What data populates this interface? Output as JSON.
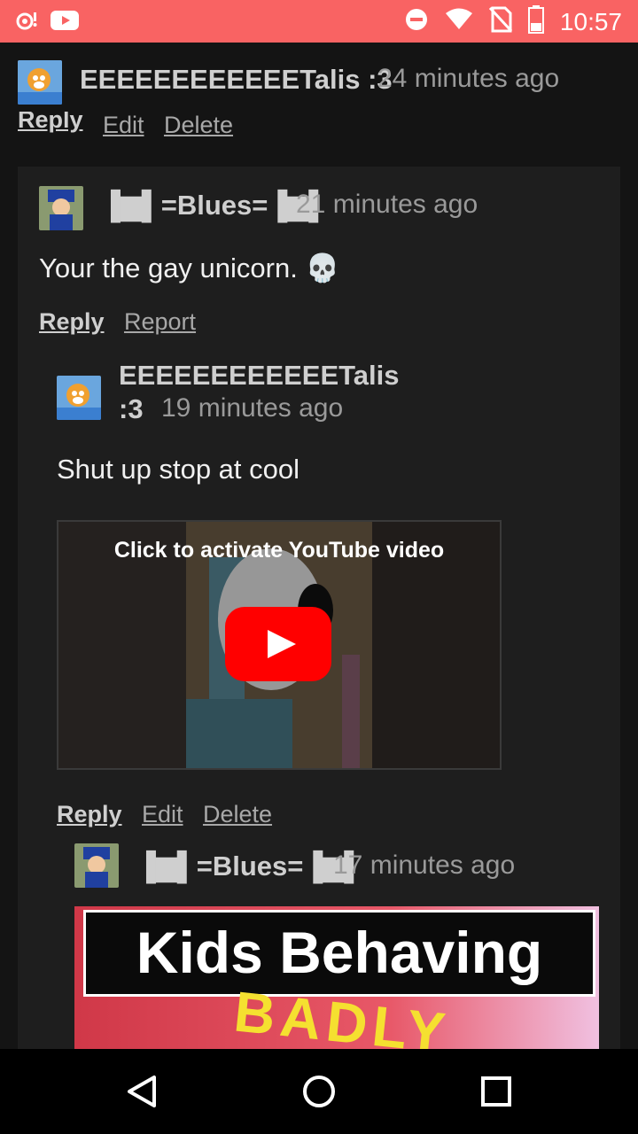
{
  "status_bar": {
    "time": "10:57",
    "icons": [
      "notification-dot-icon",
      "youtube-icon",
      "do-not-disturb-icon",
      "wifi-icon",
      "no-sim-icon",
      "battery-icon"
    ]
  },
  "comments": [
    {
      "username": "EEEEEEEEEEEETalis :3",
      "time_ago": "24 minutes ago",
      "actions": [
        "Reply",
        "Edit",
        "Delete"
      ]
    },
    {
      "username": "▐▆▌=Blues=▐▆▌",
      "time_ago": "21 minutes ago",
      "body": "Your the gay unicorn. 💀",
      "actions": [
        "Reply",
        "Report"
      ]
    },
    {
      "username_line1": "EEEEEEEEEEEETalis",
      "username_line2": ":3",
      "time_ago": "19 minutes ago",
      "body": "Shut up stop at cool",
      "video_label": "Click to activate YouTube video",
      "actions": [
        "Reply",
        "Edit",
        "Delete"
      ]
    },
    {
      "username": "▐▆▌=Blues=▐▆▌",
      "time_ago": "17 minutes ago",
      "thumbnail_line1": "Kids Behaving",
      "thumbnail_line2": "BADLY"
    }
  ],
  "nav": {
    "back": "back-icon",
    "home": "home-icon",
    "recents": "recents-icon"
  }
}
